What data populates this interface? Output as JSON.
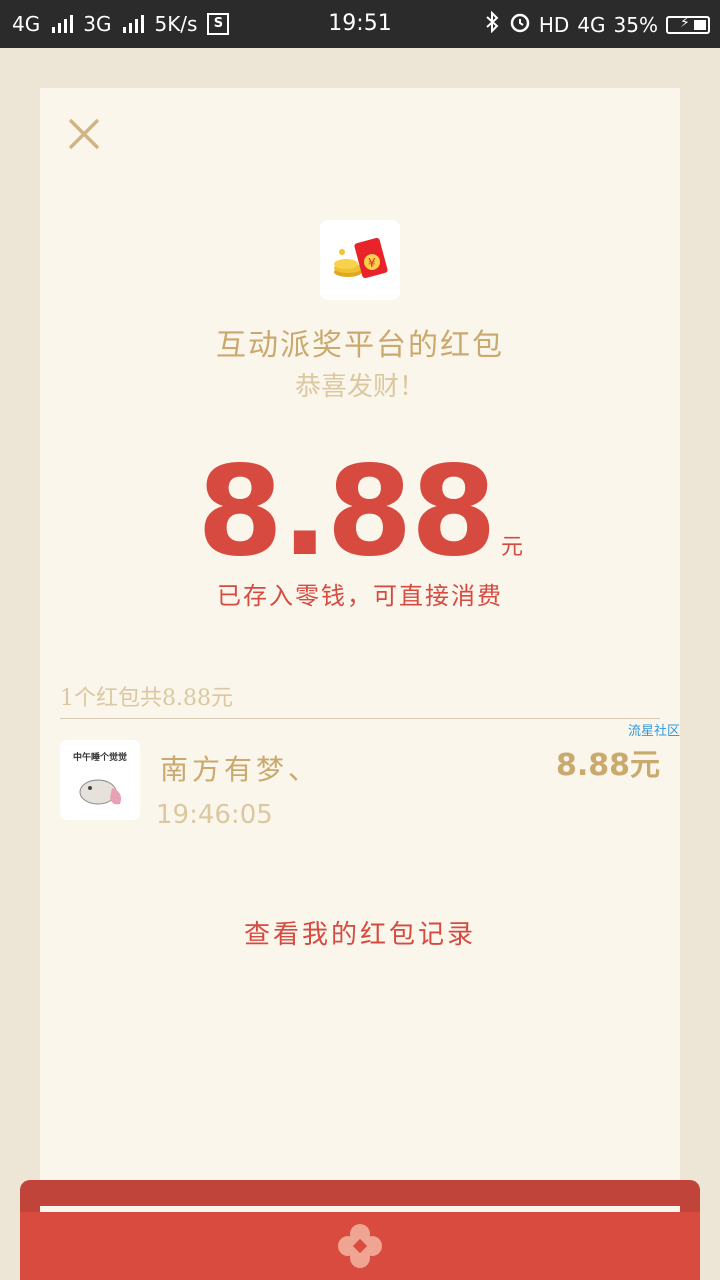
{
  "status_bar": {
    "net1": "4G",
    "net2": "3G",
    "speed": "5K/s",
    "s_badge": "S",
    "time": "19:51",
    "hd": "HD",
    "net3": "4G",
    "battery_pct": "35%"
  },
  "packet": {
    "sender": "互动派奖平台的红包",
    "greeting": "恭喜发财！",
    "amount": "8.88",
    "unit": "元",
    "stored_note": "已存入零钱，可直接消费"
  },
  "watermark": "流星社区",
  "records": {
    "summary": "1个红包共8.88元",
    "items": [
      {
        "avatar_caption": "中午睡个觉觉",
        "name": "南方有梦、",
        "time": "19:46:05",
        "amount": "8.88元"
      }
    ]
  },
  "footer_link": "查看我的红包记录",
  "colors": {
    "accent_red": "#d74a40",
    "gold": "#c9a96e",
    "card_bg": "#faf6ec"
  }
}
